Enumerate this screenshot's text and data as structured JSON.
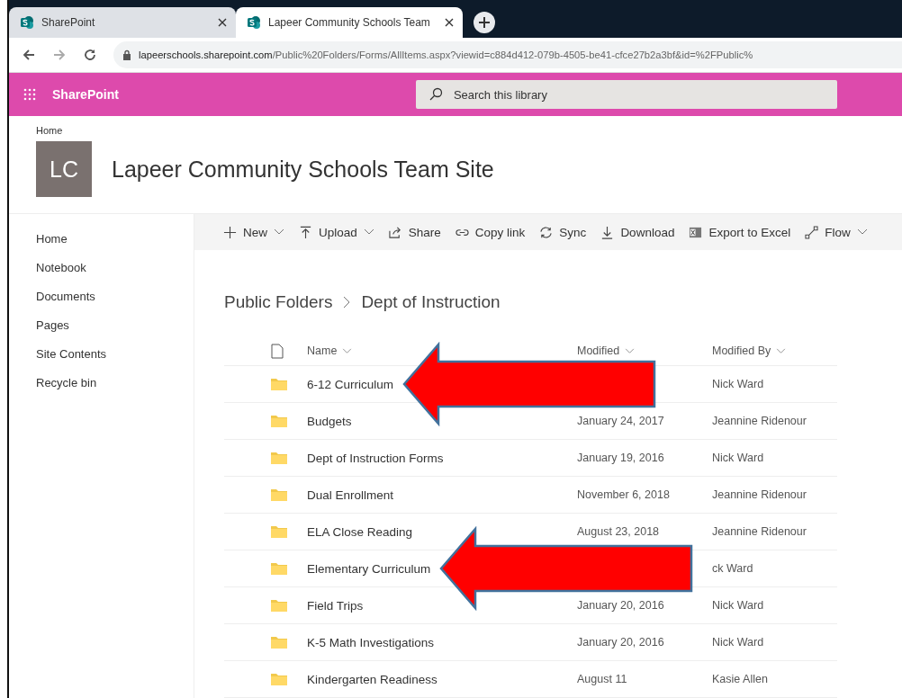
{
  "browser": {
    "tabs": [
      {
        "title": "SharePoint",
        "selected": false
      },
      {
        "title": "Lapeer Community Schools Team",
        "selected": true
      }
    ],
    "address": {
      "domain": "lapeerschools.sharepoint.com",
      "path": "/Public%20Folders/Forms/AllItems.aspx?viewid=c884d412-079b-4505-be41-cfce27b2a3bf&id=%2FPublic%"
    }
  },
  "suite_bar": {
    "app_name": "SharePoint",
    "search": {
      "placeholder": "Search this library"
    }
  },
  "site_header": {
    "breadcrumb": "Home",
    "logo": "LC",
    "title": "Lapeer Community Schools Team Site"
  },
  "sidebar": {
    "items": [
      "Home",
      "Notebook",
      "Documents",
      "Pages",
      "Site Contents",
      "Recycle bin"
    ]
  },
  "command_bar": [
    {
      "kind": "new",
      "label": "New",
      "dropdown": true
    },
    {
      "kind": "upload",
      "label": "Upload",
      "dropdown": true
    },
    {
      "kind": "share",
      "label": "Share",
      "dropdown": false
    },
    {
      "kind": "link",
      "label": "Copy link",
      "dropdown": false
    },
    {
      "kind": "sync",
      "label": "Sync",
      "dropdown": false
    },
    {
      "kind": "download",
      "label": "Download",
      "dropdown": false
    },
    {
      "kind": "excel",
      "label": "Export to Excel",
      "dropdown": false
    },
    {
      "kind": "flow",
      "label": "Flow",
      "dropdown": true
    }
  ],
  "breadcrumb": [
    "Public Folders",
    "Dept of Instruction"
  ],
  "table": {
    "columns": [
      "Name",
      "Modified",
      "Modified By"
    ],
    "rows": [
      {
        "name": "6-12 Curriculum",
        "modified": "",
        "modified_by": "Nick Ward",
        "arrow": true
      },
      {
        "name": "Budgets",
        "modified": "January 24, 2017",
        "modified_by": "Jeannine Ridenour",
        "arrow": false
      },
      {
        "name": "Dept of Instruction Forms",
        "modified": "January 19, 2016",
        "modified_by": "Nick Ward",
        "arrow": false
      },
      {
        "name": "Dual Enrollment",
        "modified": "November 6, 2018",
        "modified_by": "Jeannine Ridenour",
        "arrow": false
      },
      {
        "name": "ELA Close Reading",
        "modified": "August 23, 2018",
        "modified_by": "Jeannine Ridenour",
        "arrow": false
      },
      {
        "name": "Elementary Curriculum",
        "modified": "",
        "modified_by": "ck Ward",
        "arrow": true
      },
      {
        "name": "Field Trips",
        "modified": "January 20, 2016",
        "modified_by": "Nick Ward",
        "arrow": false
      },
      {
        "name": "K-5 Math Investigations",
        "modified": "January 20, 2016",
        "modified_by": "Nick Ward",
        "arrow": false
      },
      {
        "name": "Kindergarten Readiness",
        "modified": "August 11",
        "modified_by": "Kasie Allen",
        "arrow": false
      }
    ]
  }
}
